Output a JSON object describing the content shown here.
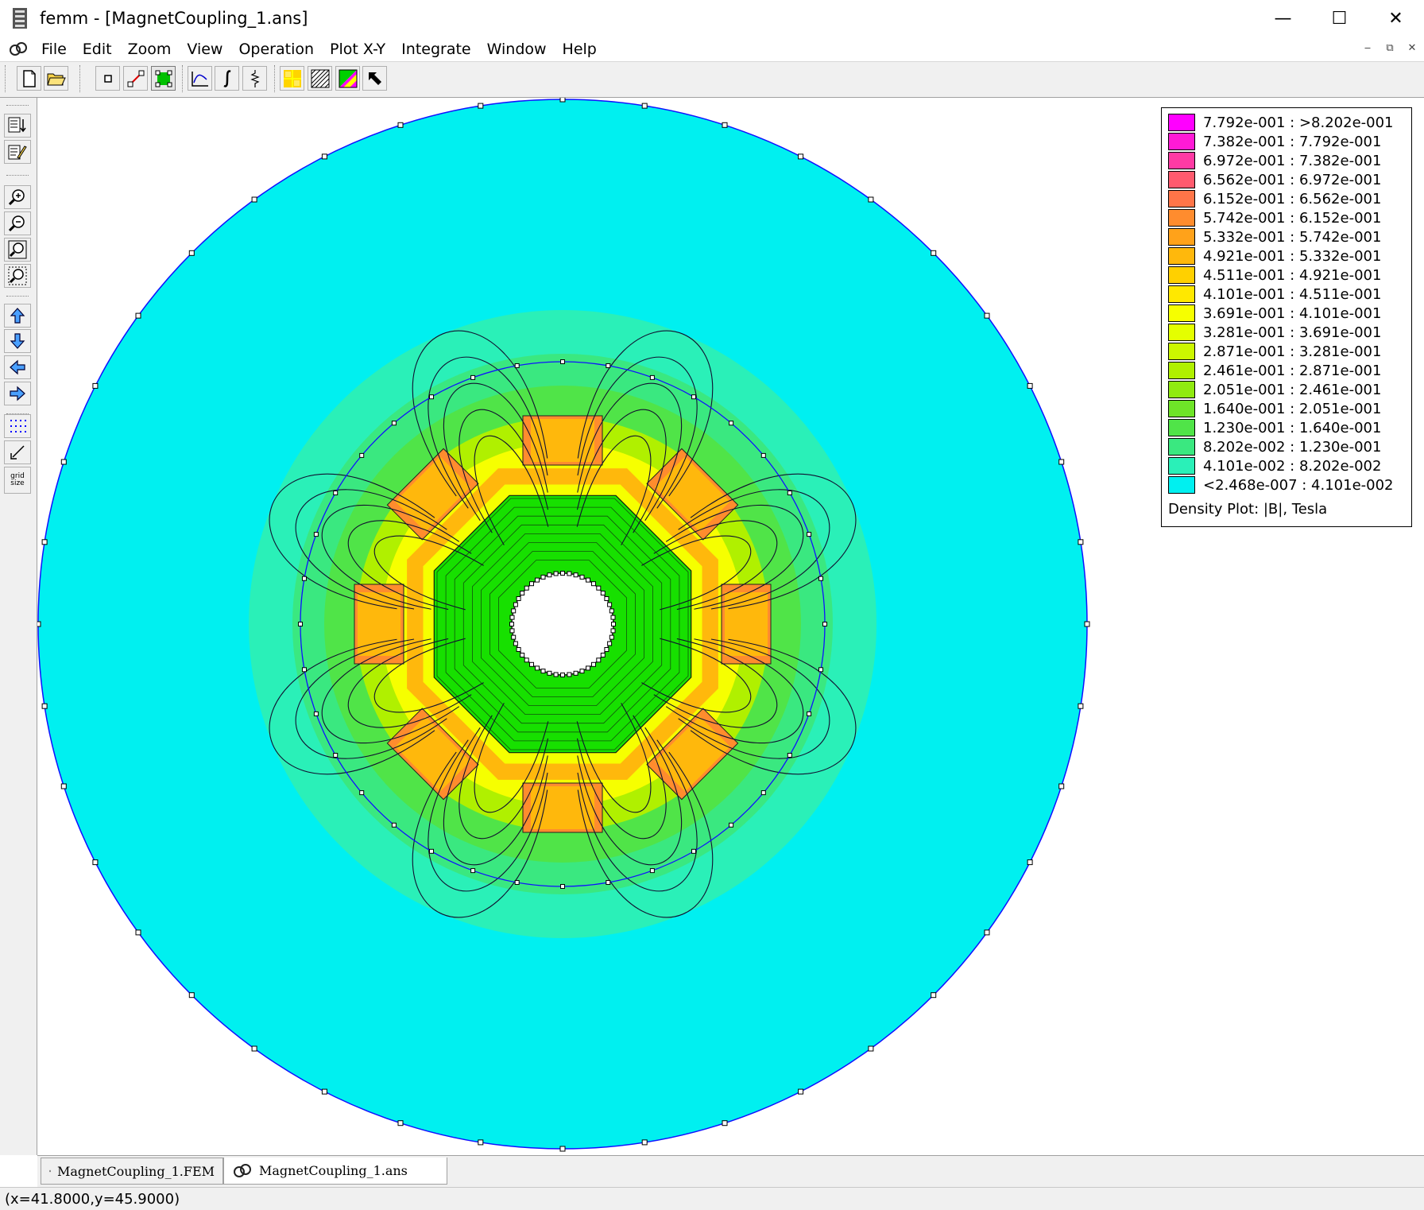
{
  "window": {
    "title": "femm - [MagnetCoupling_1.ans]",
    "minimize_glyph": "—",
    "maximize_glyph": "☐",
    "close_glyph": "✕"
  },
  "menu": [
    "File",
    "Edit",
    "Zoom",
    "View",
    "Operation",
    "Plot X-Y",
    "Integrate",
    "Window",
    "Help"
  ],
  "mdi_controls": [
    "‒",
    "⧉",
    "✕"
  ],
  "toolbar_icons": [
    "new-file-icon",
    "open-file-icon",
    "point-mode-icon",
    "segment-mode-icon",
    "block-mode-icon",
    "plot-xy-icon",
    "integrate-icon",
    "circuit-icon",
    "smooth-icon",
    "density-plot-icon",
    "contour-plot-icon",
    "vector-plot-icon",
    "pointer-icon"
  ],
  "left_toolbar_icons": [
    "results-view-icon",
    "edit-notes-icon",
    "zoom-in-icon",
    "zoom-out-icon",
    "zoom-natural-icon",
    "zoom-window-icon",
    "pan-up-icon",
    "pan-down-icon",
    "pan-left-icon",
    "pan-right-icon",
    "show-grid-icon",
    "snap-grid-icon",
    "grid-size-icon"
  ],
  "grid_size_label": "grid\nsize",
  "legend": {
    "entries": [
      {
        "label": "7.792e-001 : >8.202e-001",
        "color": "#ff00ff"
      },
      {
        "label": "7.382e-001 : 7.792e-001",
        "color": "#ff1ad6"
      },
      {
        "label": "6.972e-001 : 7.382e-001",
        "color": "#ff3aa4"
      },
      {
        "label": "6.562e-001 : 6.972e-001",
        "color": "#ff5a6e"
      },
      {
        "label": "6.152e-001 : 6.562e-001",
        "color": "#ff7548"
      },
      {
        "label": "5.742e-001 : 6.152e-001",
        "color": "#ff8c2e"
      },
      {
        "label": "5.332e-001 : 5.742e-001",
        "color": "#ffa21a"
      },
      {
        "label": "4.921e-001 : 5.332e-001",
        "color": "#ffb80c"
      },
      {
        "label": "4.511e-001 : 4.921e-001",
        "color": "#ffd000"
      },
      {
        "label": "4.101e-001 : 4.511e-001",
        "color": "#ffe800"
      },
      {
        "label": "3.691e-001 : 4.101e-001",
        "color": "#f6ff00"
      },
      {
        "label": "3.281e-001 : 3.691e-001",
        "color": "#e4ff00"
      },
      {
        "label": "2.871e-001 : 3.281e-001",
        "color": "#ccf700"
      },
      {
        "label": "2.461e-001 : 2.871e-001",
        "color": "#b0f000"
      },
      {
        "label": "2.051e-001 : 2.461e-001",
        "color": "#90ea10"
      },
      {
        "label": "1.640e-001 : 2.051e-001",
        "color": "#6ee428"
      },
      {
        "label": "1.230e-001 : 1.640e-001",
        "color": "#50e448"
      },
      {
        "label": "8.202e-002 : 1.230e-001",
        "color": "#3ae880"
      },
      {
        "label": "4.101e-002 : 8.202e-002",
        "color": "#2af0b8"
      },
      {
        "label": "<2.468e-007 : 4.101e-002",
        "color": "#00f0f0"
      }
    ],
    "caption": "Density Plot: |B|, Tesla"
  },
  "tabs": [
    {
      "label": "MagnetCoupling_1.FEM",
      "active": false
    },
    {
      "label": "MagnetCoupling_1.ans",
      "active": true
    }
  ],
  "status": {
    "text": "(x=41.8000,y=45.9000)"
  },
  "colors": {
    "outer_air": "#00f0f0",
    "field_teal": "#2af0b8",
    "field_mint": "#3ae880",
    "field_green": "#50e448",
    "iron_green": "#17e000",
    "field_yellow": "#f6ff00",
    "field_orange": "#ffb80c",
    "magnet_orange": "#ff8c2e",
    "boundary": "#1010ff"
  }
}
